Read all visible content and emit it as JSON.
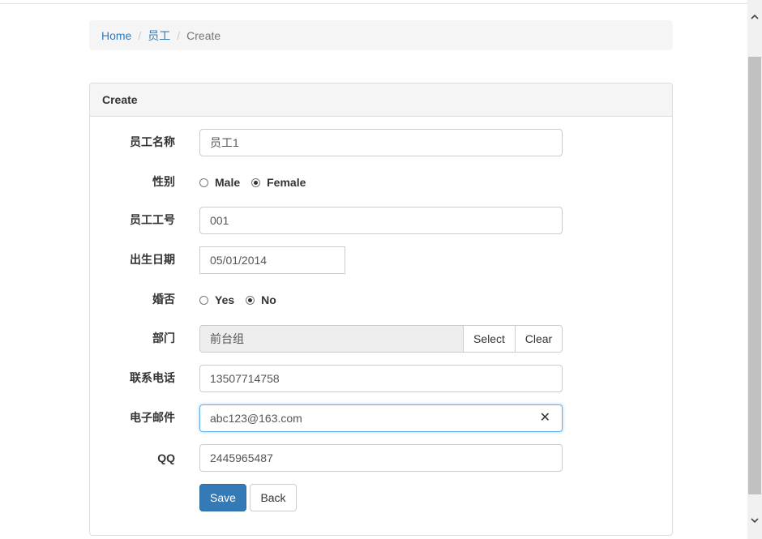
{
  "breadcrumb": {
    "home": "Home",
    "section": "员工",
    "current": "Create",
    "separator": "/"
  },
  "panel": {
    "title": "Create"
  },
  "form": {
    "name": {
      "label": "员工名称",
      "value": "员工1"
    },
    "gender": {
      "label": "性别",
      "options": [
        "Male",
        "Female"
      ],
      "selected": "Female"
    },
    "employee_no": {
      "label": "员工工号",
      "value": "001"
    },
    "birth_date": {
      "label": "出生日期",
      "value": "05/01/2014"
    },
    "married": {
      "label": "婚否",
      "options": [
        "Yes",
        "No"
      ],
      "selected": "No"
    },
    "department": {
      "label": "部门",
      "value": "前台组",
      "select_label": "Select",
      "clear_label": "Clear"
    },
    "phone": {
      "label": "联系电话",
      "value": "13507714758"
    },
    "email": {
      "label": "电子邮件",
      "value": "abc123@163.com",
      "clear_icon": "✕"
    },
    "qq": {
      "label": "QQ",
      "value": "2445965487"
    }
  },
  "actions": {
    "save_label": "Save",
    "back_label": "Back"
  },
  "colors": {
    "primary": "#337ab7",
    "focus_border": "#66afe9"
  }
}
